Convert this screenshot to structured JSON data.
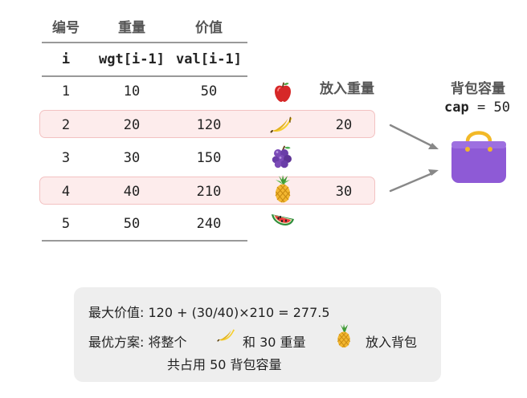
{
  "table": {
    "headers_cn": [
      "编号",
      "重量",
      "价值"
    ],
    "headers_code": [
      "i",
      "wgt[i-1]",
      "val[i-1]"
    ],
    "rows": [
      {
        "i": "1",
        "wgt": "10",
        "val": "50",
        "item": "apple",
        "put_weight": ""
      },
      {
        "i": "2",
        "wgt": "20",
        "val": "120",
        "item": "banana",
        "put_weight": "20"
      },
      {
        "i": "3",
        "wgt": "30",
        "val": "150",
        "item": "grapes",
        "put_weight": ""
      },
      {
        "i": "4",
        "wgt": "40",
        "val": "210",
        "item": "pineapple",
        "put_weight": "30"
      },
      {
        "i": "5",
        "wgt": "50",
        "val": "240",
        "item": "watermelon",
        "put_weight": ""
      }
    ]
  },
  "put_label": "放入重量",
  "bag": {
    "label": "背包容量",
    "cap_name": "cap",
    "cap_eq": "=",
    "cap_value": "50",
    "icon": "handbag-icon",
    "color": "#8e5ad6"
  },
  "summary": {
    "line1": "最大价值: 120 + (30/40)×210 = 277.5",
    "line2_prefix": "最优方案: 将整个",
    "line2_and": "和 30 重量",
    "line2_suffix": "放入背包",
    "line3": "共占用 50 背包容量"
  },
  "colors": {
    "highlight_fill": "#fdecec",
    "highlight_border": "#f3c2c2",
    "arrow": "#888888",
    "summary_bg": "#eeeeee"
  }
}
